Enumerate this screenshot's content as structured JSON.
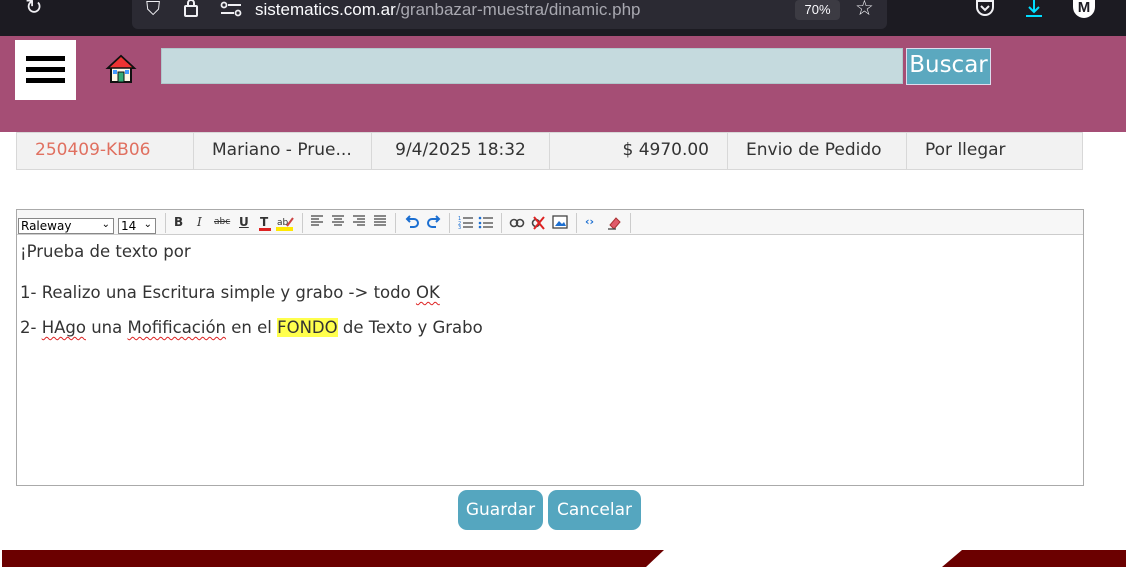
{
  "browser": {
    "url_host": "sistematics.com.ar",
    "url_path": "/granbazar-muestra/dinamic.php",
    "zoom": "70%",
    "profile_initial": "M"
  },
  "header": {
    "search_value": "",
    "search_button": "Buscar",
    "colors": {
      "header_bg": "#a54e75",
      "search_bg": "#c5dade",
      "button_bg": "#5ba8bf"
    }
  },
  "order": {
    "id": "250409-KB06",
    "customer": "Mariano - Prue...",
    "datetime": "9/4/2025 18:32",
    "amount": "$ 4970.00",
    "type": "Envio de Pedido",
    "status": "Por llegar"
  },
  "editor": {
    "font": "Raleway",
    "size": "14",
    "toolbar": {
      "bold": "B",
      "italic": "I",
      "strike": "abc",
      "underline": "U"
    },
    "lines": {
      "line1": "¡Prueba de texto por",
      "line2_a": "1- Realizo una Escritura simple y grabo -> todo ",
      "line2_b": "OK",
      "line3_a": "2- ",
      "line3_b": "HAgo",
      "line3_c": " una ",
      "line3_d": "Mofificación",
      "line3_e": " en el ",
      "line3_f": "FONDO",
      "line3_g": " de Texto y Grabo"
    }
  },
  "actions": {
    "save": "Guardar",
    "cancel": "Cancelar"
  },
  "footer": {
    "color": "#6b0000"
  }
}
